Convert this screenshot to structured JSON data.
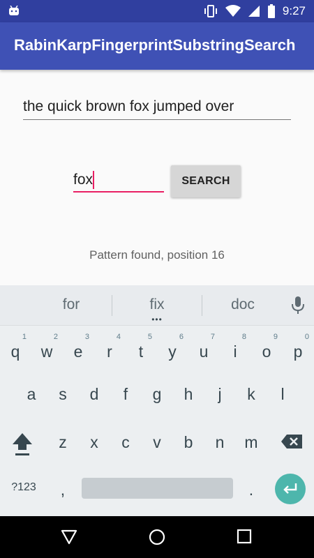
{
  "status_bar": {
    "time": "9:27",
    "icons": [
      "android-icon",
      "vibrate-icon",
      "wifi-icon",
      "signal-icon",
      "battery-icon"
    ]
  },
  "app_bar": {
    "title": "RabinKarpFingerprintSubstringSearch"
  },
  "main": {
    "text_field_value": "the quick brown fox jumped over",
    "pattern_field_value": "fox",
    "search_button_label": "SEARCH",
    "result_text": "Pattern found, position 16"
  },
  "keyboard": {
    "suggestions": [
      "for",
      "fix",
      "doc"
    ],
    "row1": [
      {
        "key": "q",
        "hint": "1"
      },
      {
        "key": "w",
        "hint": "2"
      },
      {
        "key": "e",
        "hint": "3"
      },
      {
        "key": "r",
        "hint": "4"
      },
      {
        "key": "t",
        "hint": "5"
      },
      {
        "key": "y",
        "hint": "6"
      },
      {
        "key": "u",
        "hint": "7"
      },
      {
        "key": "i",
        "hint": "8"
      },
      {
        "key": "o",
        "hint": "9"
      },
      {
        "key": "p",
        "hint": "0"
      }
    ],
    "row2": [
      "a",
      "s",
      "d",
      "f",
      "g",
      "h",
      "j",
      "k",
      "l"
    ],
    "row3": [
      "z",
      "x",
      "c",
      "v",
      "b",
      "n",
      "m"
    ],
    "symbols_key": "?123",
    "comma_key": ",",
    "period_key": "."
  },
  "colors": {
    "status_bar": "#303f9f",
    "app_bar": "#3f51b5",
    "accent": "#e91e63",
    "enter_key": "#4db6ac"
  }
}
